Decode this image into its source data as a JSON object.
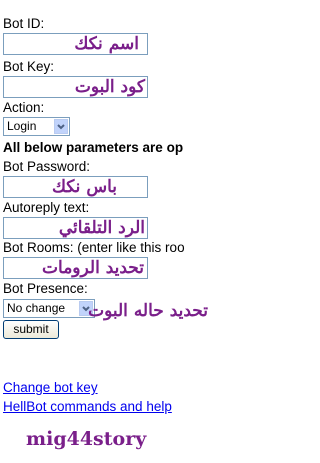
{
  "form": {
    "bot_id_label": "Bot ID:",
    "bot_id_note": "اسم نكك",
    "bot_key_label": "Bot Key:",
    "bot_key_note": "كود البوت",
    "action_label": "Action:",
    "action_selected": "Login",
    "notice": "All below parameters are op",
    "bot_password_label": "Bot Password:",
    "bot_password_note": "باس نكك",
    "autoreply_label": "Autoreply text:",
    "autoreply_note": "الرد التلقائي",
    "bot_rooms_label": "Bot Rooms: (enter like this roo",
    "bot_rooms_note": "تحديد الرومات",
    "bot_presence_label": "Bot Presence:",
    "bot_presence_selected": "No change",
    "bot_presence_note": "تحديد حاله البوت",
    "submit_label": "submit"
  },
  "links": {
    "change_key": "Change bot key",
    "commands_help": "HellBot commands and help"
  },
  "footer": {
    "watermark": "mig44story"
  },
  "colors": {
    "annotation": "#7a1f8a",
    "link": "#0000ee",
    "input_border": "#7b9ebd"
  }
}
